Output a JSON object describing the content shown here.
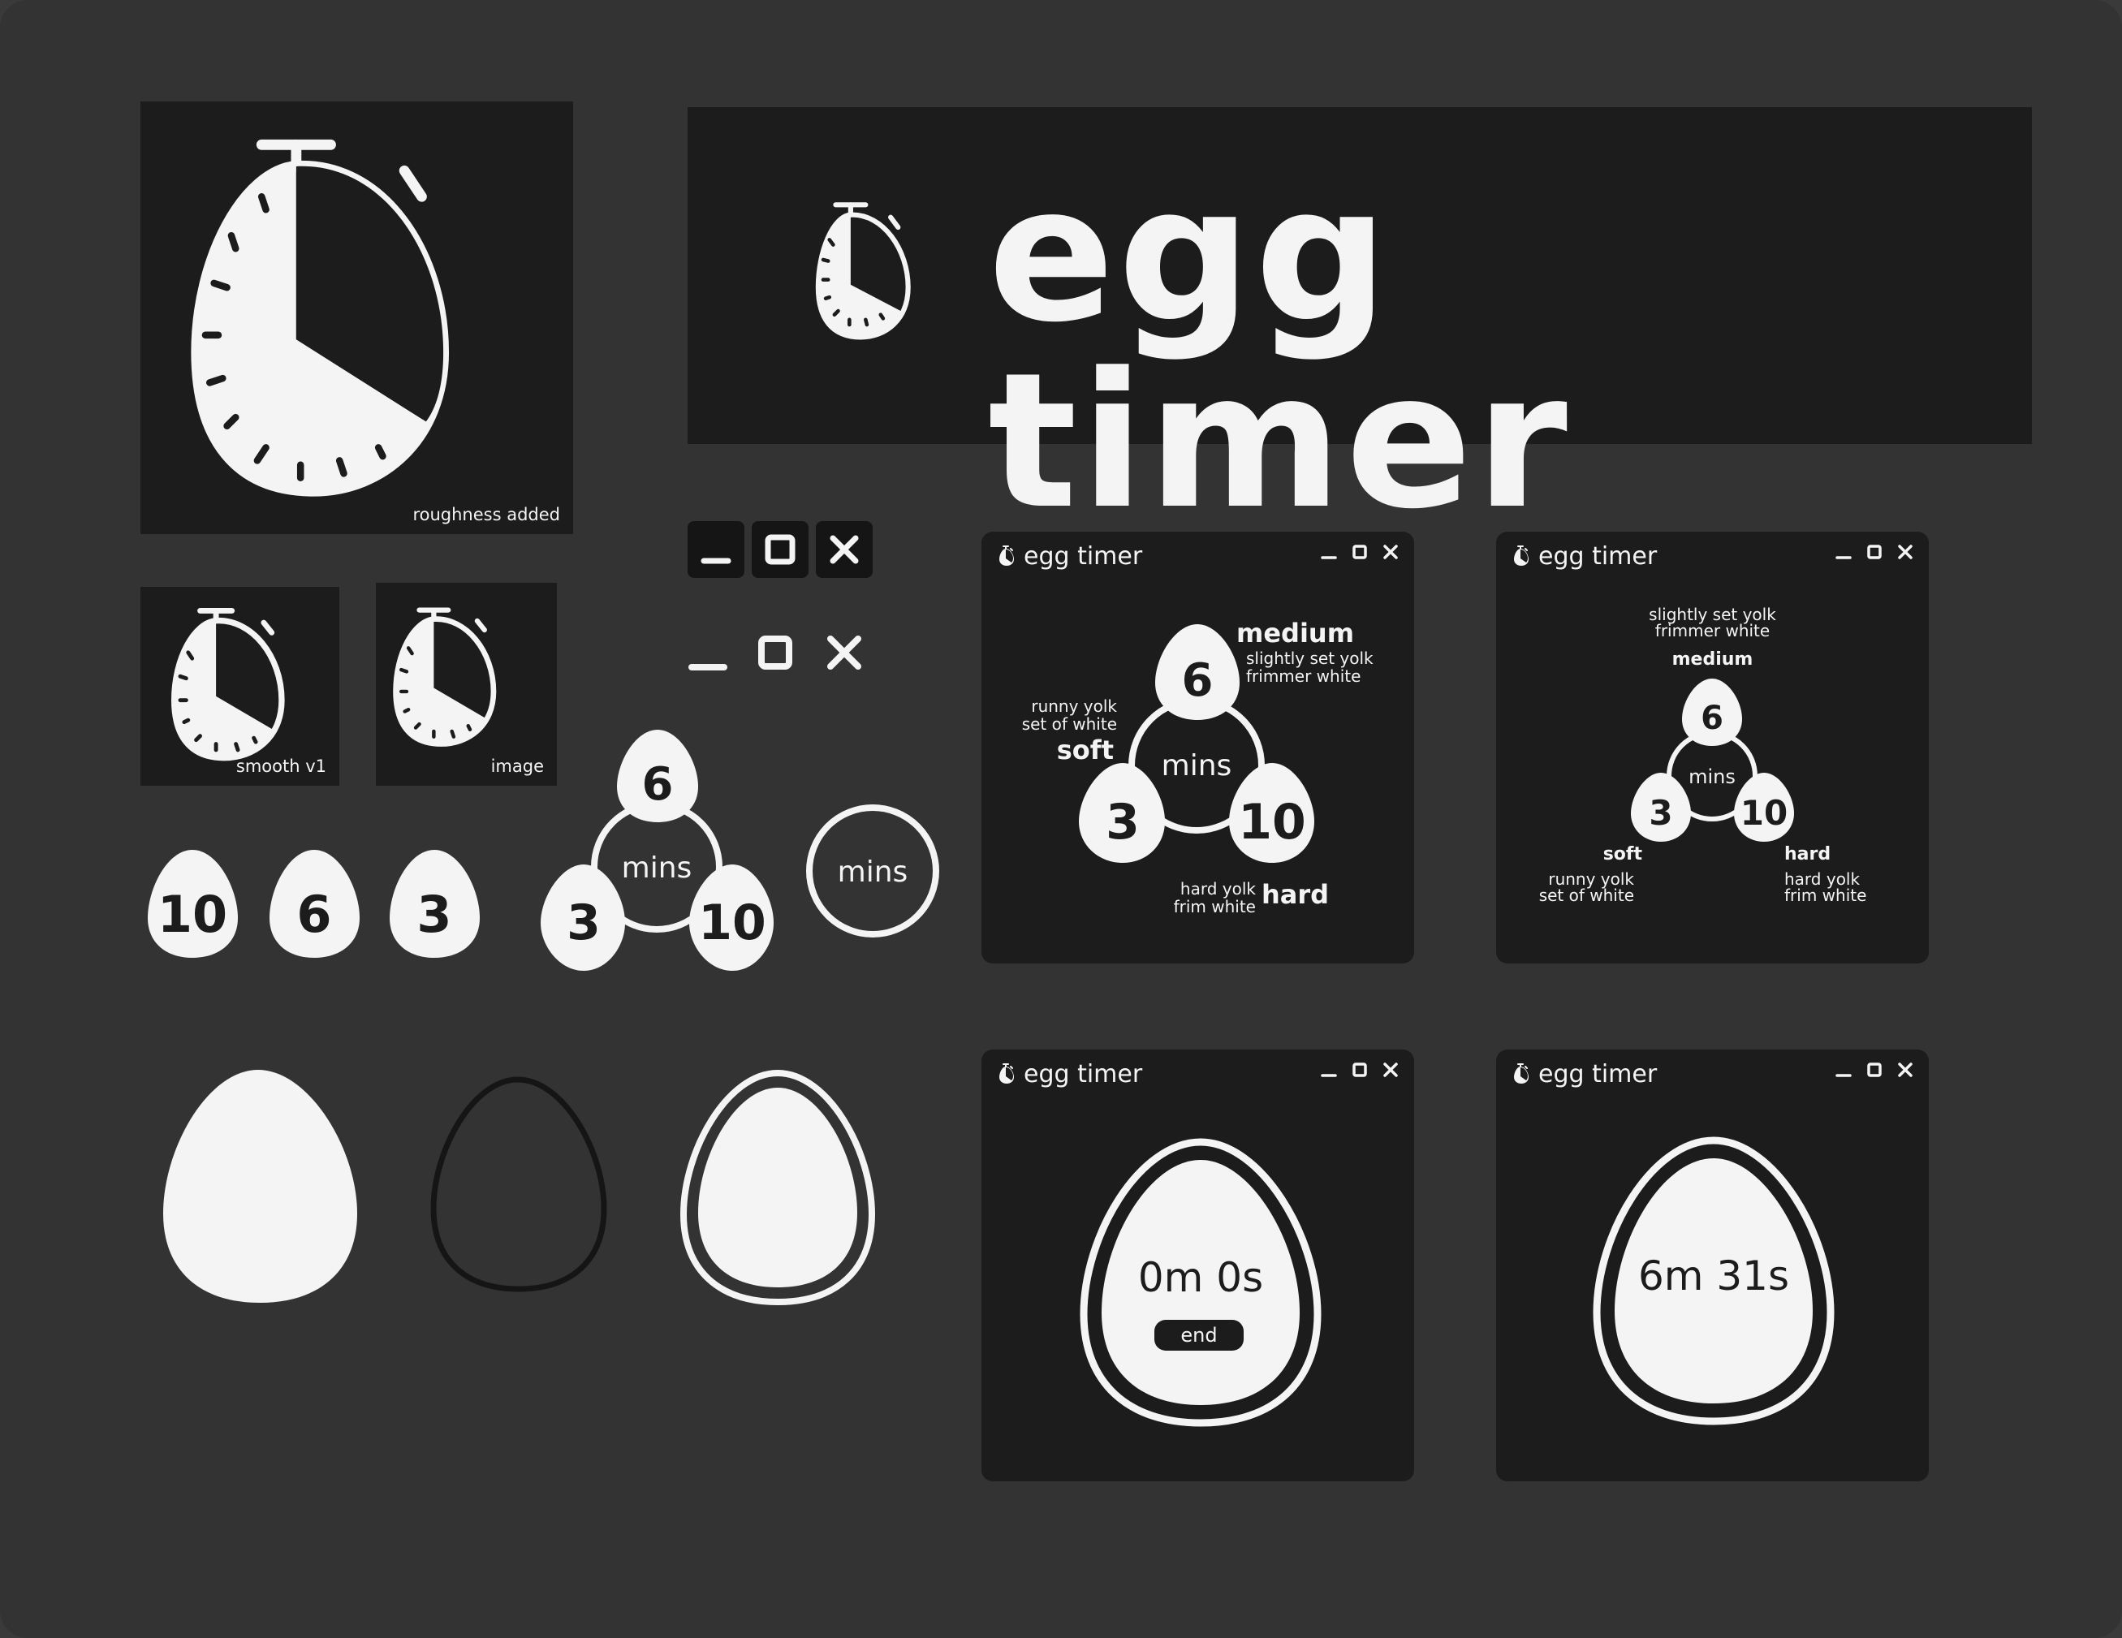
{
  "colors": {
    "background": "#333333",
    "panel": "#1c1c1c",
    "foreground": "#f4f4f4"
  },
  "icons": {
    "stopwatch": "stopwatch-egg-icon",
    "minimize": "minimize-icon",
    "maximize": "maximize-icon",
    "close": "close-icon",
    "egg": "egg-icon"
  },
  "icon_variants": {
    "large_caption": "roughness added",
    "smooth_caption": "smooth v1",
    "image_caption": "image"
  },
  "logo": {
    "text": "egg timer"
  },
  "eggs": {
    "ten": "10",
    "six": "6",
    "three": "3"
  },
  "mins_label": "mins",
  "window_title": "egg timer",
  "selector_window_a": {
    "medium": {
      "label": "medium",
      "line1": "slightly set yolk",
      "line2": "frimmer white",
      "value": "6"
    },
    "soft": {
      "label": "soft",
      "line1": "runny yolk",
      "line2": "set of white",
      "value": "3"
    },
    "hard": {
      "label": "hard",
      "line1": "hard yolk",
      "line2": "frim white",
      "value": "10"
    },
    "mins": "mins"
  },
  "selector_window_b": {
    "medium": {
      "label": "medium",
      "line1": "slightly set yolk",
      "line2": "frimmer white",
      "value": "6"
    },
    "soft": {
      "label": "soft",
      "line1": "runny yolk",
      "line2": "set of white",
      "value": "3"
    },
    "hard": {
      "label": "hard",
      "line1": "hard yolk",
      "line2": "frim white",
      "value": "10"
    },
    "mins": "mins"
  },
  "timer_window_a": {
    "time": "0m 0s",
    "end_label": "end"
  },
  "timer_window_b": {
    "time": "6m 31s"
  }
}
